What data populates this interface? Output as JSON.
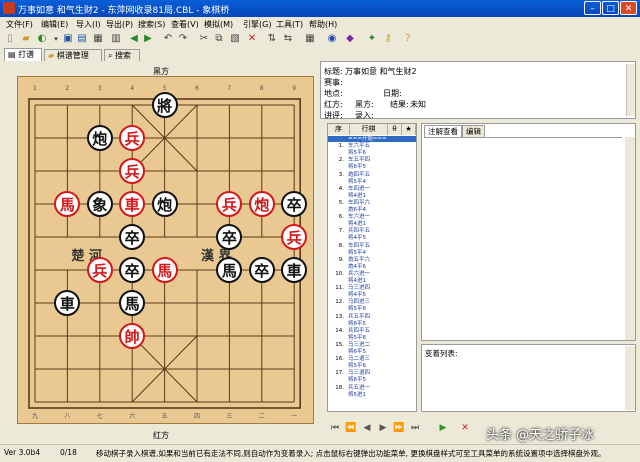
{
  "window": {
    "title": "万事如意 和气生财2 - 东萍网收录81局.CBL - 象棋桥"
  },
  "menu": [
    "文件(F)",
    "编辑(E)",
    "导入(I)",
    "导出(P)",
    "搜索(S)",
    "查看(V)",
    "模拟(M)",
    "引擎(G)",
    "工具(T)",
    "帮助(H)"
  ],
  "tabs": [
    {
      "label": "打谱",
      "active": true
    },
    {
      "label": "棋谱管理",
      "active": false
    },
    {
      "label": "搜索",
      "active": false
    }
  ],
  "board": {
    "top_label": "黑方",
    "bottom_label": "红方",
    "river_left": "楚 河",
    "river_right": "漢 界",
    "top_numbers": [
      "1",
      "2",
      "3",
      "4",
      "5",
      "6",
      "7",
      "8",
      "9"
    ],
    "bottom_numbers": [
      "九",
      "八",
      "七",
      "六",
      "五",
      "四",
      "三",
      "二",
      "一"
    ],
    "pieces": [
      {
        "char": "將",
        "side": "black",
        "col": 4,
        "row": 0
      },
      {
        "char": "炮",
        "side": "black",
        "col": 2,
        "row": 1
      },
      {
        "char": "兵",
        "side": "red",
        "col": 3,
        "row": 1
      },
      {
        "char": "兵",
        "side": "red",
        "col": 3,
        "row": 2
      },
      {
        "char": "馬",
        "side": "red",
        "col": 1,
        "row": 3
      },
      {
        "char": "象",
        "side": "black",
        "col": 2,
        "row": 3
      },
      {
        "char": "車",
        "side": "red",
        "col": 3,
        "row": 3
      },
      {
        "char": "炮",
        "side": "black",
        "col": 4,
        "row": 3
      },
      {
        "char": "兵",
        "side": "red",
        "col": 6,
        "row": 3
      },
      {
        "char": "炮",
        "side": "red",
        "col": 7,
        "row": 3
      },
      {
        "char": "卒",
        "side": "black",
        "col": 8,
        "row": 3
      },
      {
        "char": "卒",
        "side": "black",
        "col": 3,
        "row": 4
      },
      {
        "char": "卒",
        "side": "black",
        "col": 6,
        "row": 4
      },
      {
        "char": "兵",
        "side": "red",
        "col": 8,
        "row": 4
      },
      {
        "char": "兵",
        "side": "red",
        "col": 2,
        "row": 5
      },
      {
        "char": "卒",
        "side": "black",
        "col": 3,
        "row": 5
      },
      {
        "char": "馬",
        "side": "red",
        "col": 4,
        "row": 5
      },
      {
        "char": "馬",
        "side": "black",
        "col": 6,
        "row": 5
      },
      {
        "char": "卒",
        "side": "black",
        "col": 7,
        "row": 5
      },
      {
        "char": "車",
        "side": "black",
        "col": 8,
        "row": 5
      },
      {
        "char": "車",
        "side": "black",
        "col": 1,
        "row": 6
      },
      {
        "char": "馬",
        "side": "black",
        "col": 3,
        "row": 6
      },
      {
        "char": "帥",
        "side": "red",
        "col": 3,
        "row": 7
      }
    ]
  },
  "info": {
    "title_label": "标题:",
    "title_value": "万事如意 和气生财2",
    "event_label": "赛事:",
    "place_label": "地点:",
    "date_label": "日期:",
    "red_label": "红方:",
    "black_label": "黑方:",
    "result_label": "结果:",
    "result_value": "未知",
    "commentator_label": "讲评:",
    "recorder_label": "录入:"
  },
  "movelist": {
    "headers": [
      "序",
      "行棋",
      "θ",
      "★"
    ],
    "moves": [
      {
        "n": "",
        "m": "===开始==="
      },
      {
        "n": "1.",
        "m": "车六平五"
      },
      {
        "n": "",
        "m": "将5平6"
      },
      {
        "n": "2.",
        "m": "车五平四"
      },
      {
        "n": "",
        "m": "将6平5"
      },
      {
        "n": "3.",
        "m": "炮四平五"
      },
      {
        "n": "",
        "m": "将5平4"
      },
      {
        "n": "4.",
        "m": "车四进一"
      },
      {
        "n": "",
        "m": "将4进1"
      },
      {
        "n": "5.",
        "m": "车四平六"
      },
      {
        "n": "",
        "m": "炮6平4"
      },
      {
        "n": "6.",
        "m": "车六进一"
      },
      {
        "n": "",
        "m": "将4进1"
      },
      {
        "n": "7.",
        "m": "兵四平五"
      },
      {
        "n": "",
        "m": "将4平5"
      },
      {
        "n": "8.",
        "m": "车四平五"
      },
      {
        "n": "",
        "m": "将5平4"
      },
      {
        "n": "9.",
        "m": "炮五平六"
      },
      {
        "n": "",
        "m": "炮4平6"
      },
      {
        "n": "10.",
        "m": "兵六进一"
      },
      {
        "n": "",
        "m": "将4进1"
      },
      {
        "n": "11.",
        "m": "马三进四"
      },
      {
        "n": "",
        "m": "将4平5"
      },
      {
        "n": "12.",
        "m": "马四进三"
      },
      {
        "n": "",
        "m": "将5平6"
      },
      {
        "n": "13.",
        "m": "兵五平四"
      },
      {
        "n": "",
        "m": "将6平5"
      },
      {
        "n": "14.",
        "m": "兵四平五"
      },
      {
        "n": "",
        "m": "将5平6"
      },
      {
        "n": "15.",
        "m": "马三进二"
      },
      {
        "n": "",
        "m": "将6平5"
      },
      {
        "n": "16.",
        "m": "马二退三"
      },
      {
        "n": "",
        "m": "将5平6"
      },
      {
        "n": "17.",
        "m": "马三退四"
      },
      {
        "n": "",
        "m": "将6平5"
      },
      {
        "n": "18.",
        "m": "兵五进一"
      },
      {
        "n": "",
        "m": "将5进1"
      }
    ]
  },
  "comment_tabs": [
    "注解查看",
    "编辑"
  ],
  "variations_label": "变着列表:",
  "status": {
    "version": "Ver 3.0b4",
    "position": "0/18",
    "message": "移动棋子录入棋谱,如果和当前已有走法不同,则自动作为变着录入; 点击鼠标右键弹出功能菜单, 更换棋盘样式可至工具菜单的系统设置项中选择棋盘外观。",
    "watermark": "头条 @天之骄子冰"
  },
  "colors": {
    "board": "#e9c891",
    "red": "#d21818",
    "black": "#111111",
    "accent": "#0a5fd8"
  }
}
